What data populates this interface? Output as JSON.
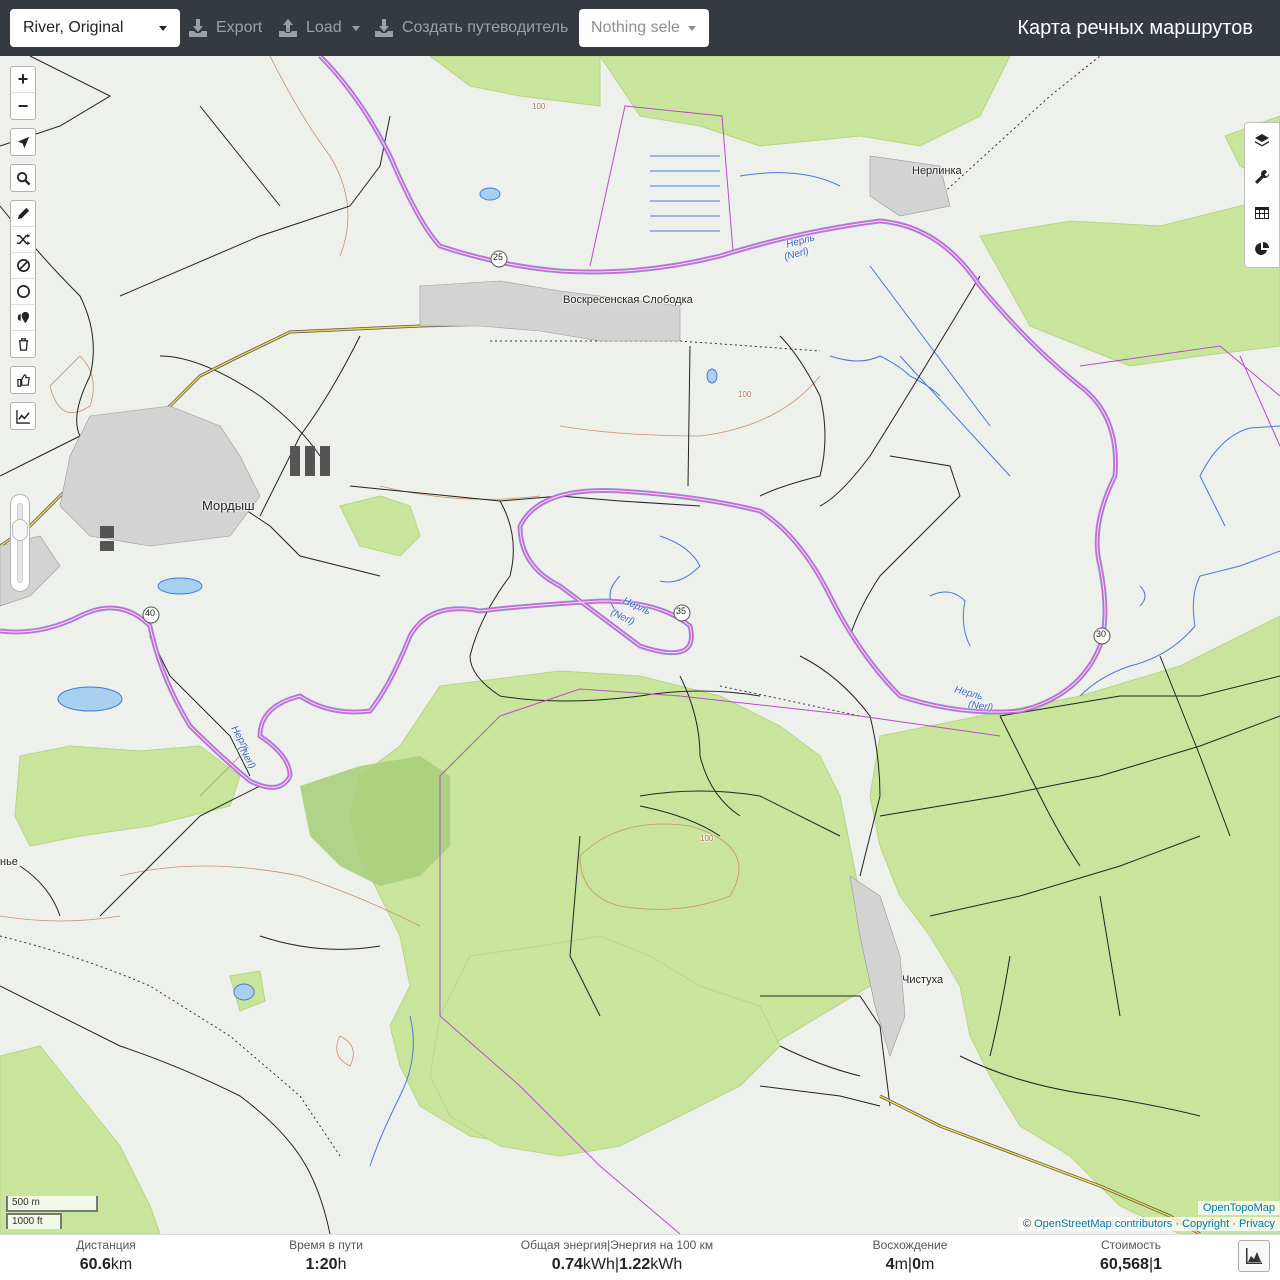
{
  "header": {
    "profile_value": "River, Original",
    "export_label": "Export",
    "load_label": "Load",
    "guide_label": "Создать путеводитель",
    "nothing_selected": "Nothing sele",
    "app_title": "Карта речных маршрутов"
  },
  "map": {
    "places": {
      "nerlinka": "Нерлинка",
      "voskresenskaya": "Воскресенская Слободка",
      "mordysh": "Мордыш",
      "chistukha": "Чистуха",
      "edge_village": "нье"
    },
    "river_labels": {
      "r1a": "Нерль",
      "r1b": "(Nerl)",
      "r2a": "Нерль",
      "r2b": "(Nerl)",
      "r3a": "Нерль",
      "r3b": "(Nerl)",
      "r4a": "Нерль",
      "r4b": "(Nerl)"
    },
    "km_markers": [
      "25",
      "35",
      "40",
      "30"
    ],
    "contour_label": "100",
    "left_controls": [
      "zoom-in",
      "zoom-out",
      "locate",
      "search",
      "draw",
      "shuffle",
      "no-entry",
      "circle",
      "poi",
      "delete",
      "thumb",
      "chart"
    ],
    "zoom_in_label": "+",
    "zoom_out_label": "−",
    "right_controls": [
      "layers-icon",
      "wrench-icon",
      "table-icon",
      "pie-chart-icon"
    ]
  },
  "scale": {
    "metric": "500 m",
    "imperial": "1000 ft"
  },
  "attribution": {
    "opentopomap": "OpenTopoMap",
    "copy_prefix": "© ",
    "osm": "OpenStreetMap contributors",
    "sep1": " · ",
    "copyright": "Copyright",
    "sep2": " · ",
    "privacy": "Privacy"
  },
  "stats": {
    "distance_label": "Дистанция",
    "distance_value": "60.6",
    "distance_unit": "km",
    "time_label": "Время в пути",
    "time_value": "1:20",
    "time_unit": "h",
    "energy_label": "Общая энергия|Энергия на 100 км",
    "energy_value1": "0.74",
    "energy_value2": "1.22",
    "energy_unit": "kWh",
    "ascent_label": "Восхождение",
    "ascent_value1": "4",
    "ascent_value2": "0",
    "ascent_unit": "m",
    "cost_label": "Стоимость",
    "cost_value": "60,568",
    "cost_value2": "1",
    "pipe": "|"
  },
  "colors": {
    "topbar": "#343a40",
    "route": "#c56bd6",
    "river": "#4a78d6",
    "forest": "#c9e59b"
  }
}
